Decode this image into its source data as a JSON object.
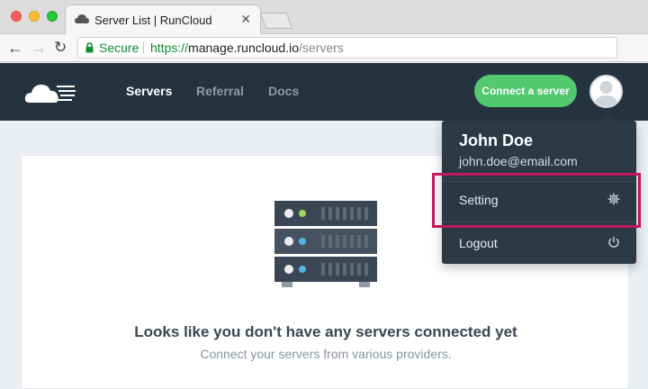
{
  "browser": {
    "tab_title": "Server List | RunCloud",
    "tab_close": "✕",
    "nav_back": "←",
    "nav_forward": "→",
    "nav_reload": "↻",
    "secure_label": "Secure",
    "url_protocol": "https://",
    "url_host": "manage.runcloud.io",
    "url_path": "/servers"
  },
  "header": {
    "menu": {
      "servers": "Servers",
      "referral": "Referral",
      "docs": "Docs"
    },
    "connect_button": "Connect a server"
  },
  "dropdown": {
    "name": "John Doe",
    "email": "john.doe@email.com",
    "setting_label": "Setting",
    "logout_label": "Logout"
  },
  "main": {
    "empty_title": "Looks like you don't have any servers connected yet",
    "empty_subtitle": "Connect your servers from various providers."
  },
  "colors": {
    "header_bg": "#253341",
    "accent_green": "#52c86f",
    "highlight": "#c2185b",
    "dropdown_bg": "#2c3a48"
  },
  "icons": {
    "logo": "runcloud-cloud-logo",
    "favicon": "cloud-icon",
    "lock": "lock-icon",
    "avatar": "user-avatar-icon",
    "setting": "gear-icon",
    "logout": "power-icon",
    "illustration": "server-rack-icon"
  }
}
